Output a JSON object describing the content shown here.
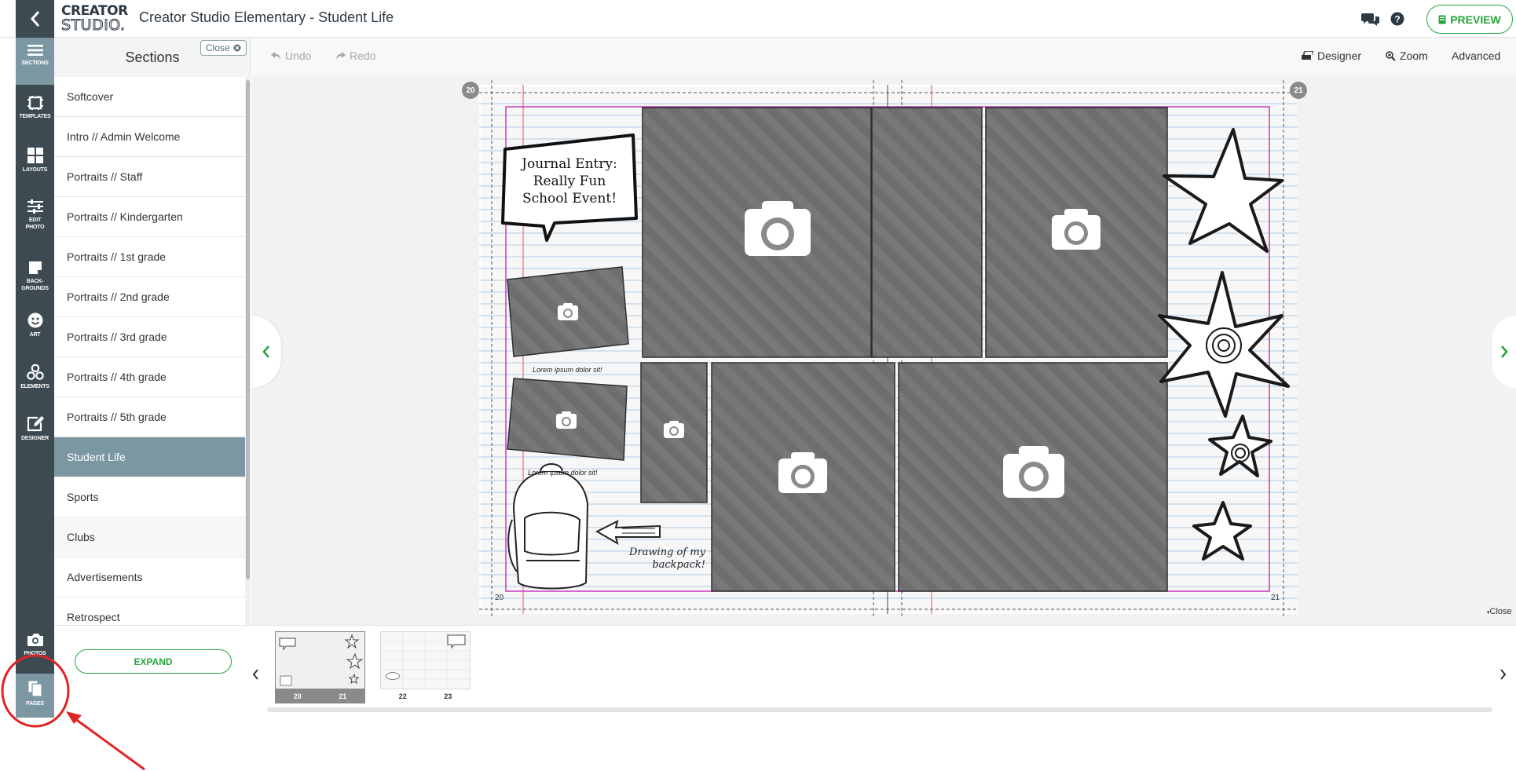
{
  "app": {
    "logo_line1": "CREATOR",
    "logo_line2": "STUDIO.",
    "title": "Creator Studio Elementary - Student Life",
    "preview_label": "PREVIEW"
  },
  "rail": {
    "items": [
      {
        "label": "SECTIONS",
        "icon": "menu-icon"
      },
      {
        "label": "TEMPLATES",
        "icon": "templates-icon"
      },
      {
        "label": "LAYOUTS",
        "icon": "layouts-icon"
      },
      {
        "label": "EDIT PHOTO",
        "icon": "sliders-icon"
      },
      {
        "label": "BACK-GROUNDS",
        "icon": "backgrounds-icon"
      },
      {
        "label": "ART",
        "icon": "smiley-icon"
      },
      {
        "label": "ELEMENTS",
        "icon": "elements-icon"
      },
      {
        "label": "DESIGNER",
        "icon": "edit-icon"
      },
      {
        "label": "PHOTOS",
        "icon": "camera-icon"
      },
      {
        "label": "PAGES",
        "icon": "pages-icon"
      }
    ]
  },
  "sections": {
    "title": "Sections",
    "close_label": "Close",
    "items": [
      "Softcover",
      "Intro // Admin Welcome",
      "Portraits // Staff",
      "Portraits // Kindergarten",
      "Portraits // 1st grade",
      "Portraits // 2nd grade",
      "Portraits // 3rd grade",
      "Portraits // 4th grade",
      "Portraits // 5th grade",
      "Student Life",
      "Sports",
      "Clubs",
      "Advertisements",
      "Retrospect"
    ],
    "active": "Student Life"
  },
  "toolbar": {
    "undo": "Undo",
    "redo": "Redo",
    "designer": "Designer",
    "zoom": "Zoom",
    "advanced": "Advanced"
  },
  "spread": {
    "left_page": "20",
    "right_page": "21",
    "journal_line1": "Journal Entry:",
    "journal_line2": "Really Fun",
    "journal_line3": "School Event!",
    "caption1": "Lorem ipsum dolor sit!",
    "caption2": "Lorem ipsum dolor sit!",
    "drawing_line1": "Drawing of my",
    "drawing_line2": "backpack!"
  },
  "canvas": {
    "close_label": "Close"
  },
  "pages_strip": {
    "expand_label": "EXPAND",
    "thumbs": [
      {
        "left": "20",
        "right": "21",
        "selected": true
      },
      {
        "left": "22",
        "right": "23",
        "selected": false
      }
    ]
  },
  "colors": {
    "rail_bg": "#3d4a52",
    "rail_active": "#7b97a2",
    "accent_green": "#24a53c",
    "annotation_red": "#e02424",
    "photo_placeholder": "#6e6e6e",
    "bleed_magenta": "#c21fb4"
  }
}
